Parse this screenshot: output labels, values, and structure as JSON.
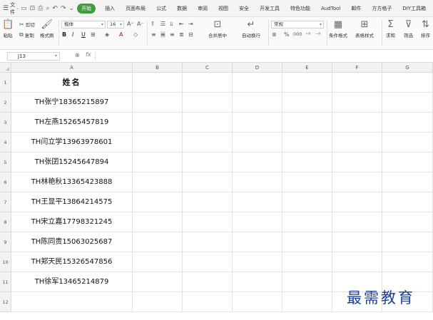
{
  "menu": {
    "file_label": "文件",
    "tabs": [
      {
        "label": "开始",
        "active": true
      },
      {
        "label": "插入"
      },
      {
        "label": "页面布局"
      },
      {
        "label": "公式"
      },
      {
        "label": "数据"
      },
      {
        "label": "审阅"
      },
      {
        "label": "视图"
      },
      {
        "label": "安全"
      },
      {
        "label": "开发工具"
      },
      {
        "label": "特色功能"
      },
      {
        "label": "AudTool"
      },
      {
        "label": "邮件"
      },
      {
        "label": "方方格子"
      },
      {
        "label": "DIY工具箱"
      }
    ],
    "accent_color": "#3e9d3e"
  },
  "toolbar": {
    "paste": "粘贴",
    "cut": "剪切",
    "copy": "复制",
    "format_painter": "格式刷",
    "font_name": "楷体",
    "font_size": "16",
    "bold": "B",
    "italic": "I",
    "underline": "U",
    "merge_center": "合并居中",
    "wrap_text": "自动换行",
    "number_format": "常规",
    "percent": "%",
    "thousands": "000",
    "cond_format": "条件格式",
    "table_style": "表格样式",
    "sum": "求和",
    "filter": "筛选",
    "sort": "排序"
  },
  "formula_bar": {
    "name_box": "J13",
    "fx": "fx",
    "value": ""
  },
  "sheet": {
    "columns": [
      "A",
      "B",
      "C",
      "D",
      "E",
      "F",
      "G"
    ],
    "rows": [
      "1",
      "2",
      "3",
      "4",
      "5",
      "6",
      "7",
      "8",
      "9",
      "10",
      "11",
      "12"
    ],
    "col_a": [
      "姓名",
      "TH张宁18365215897",
      "TH左燕15265457819",
      "TH闫立学13963978601",
      "TH张囝15245647894",
      "TH林艳秋13365423888",
      "TH王显平13864214575",
      "TH宋立嘉17798321245",
      "TH陈同贵15063025687",
      "TH郑天民15326547856",
      "TH徐军13465214879",
      ""
    ]
  },
  "watermark": "最需教育"
}
